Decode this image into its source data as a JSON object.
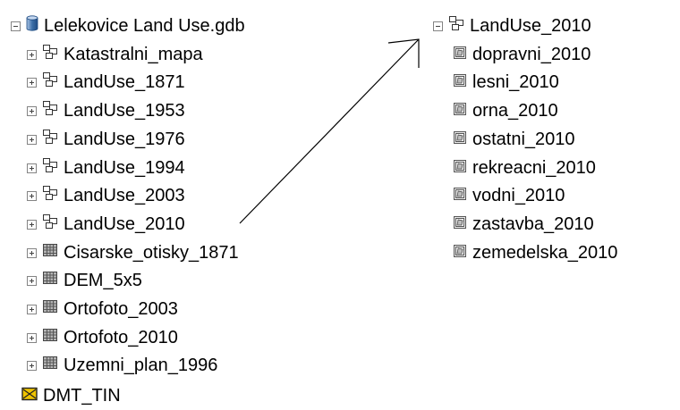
{
  "left_tree": {
    "root": {
      "label": "Lelekovice Land Use.gdb",
      "icon": "database-icon"
    },
    "items": [
      {
        "label": "Katastralni_mapa",
        "icon": "feature-dataset-icon"
      },
      {
        "label": "LandUse_1871",
        "icon": "feature-dataset-icon"
      },
      {
        "label": "LandUse_1953",
        "icon": "feature-dataset-icon"
      },
      {
        "label": "LandUse_1976",
        "icon": "feature-dataset-icon"
      },
      {
        "label": "LandUse_1994",
        "icon": "feature-dataset-icon"
      },
      {
        "label": "LandUse_2003",
        "icon": "feature-dataset-icon"
      },
      {
        "label": "LandUse_2010",
        "icon": "feature-dataset-icon"
      },
      {
        "label": "Cisarske_otisky_1871",
        "icon": "raster-dataset-icon"
      },
      {
        "label": "DEM_5x5",
        "icon": "raster-dataset-icon"
      },
      {
        "label": "Ortofoto_2003",
        "icon": "raster-dataset-icon"
      },
      {
        "label": "Ortofoto_2010",
        "icon": "raster-dataset-icon"
      },
      {
        "label": "Uzemni_plan_1996",
        "icon": "raster-dataset-icon"
      }
    ],
    "tin": {
      "label": "DMT_TIN",
      "icon": "tin-icon"
    }
  },
  "right_tree": {
    "root": {
      "label": "LandUse_2010",
      "icon": "feature-dataset-icon"
    },
    "items": [
      {
        "label": "dopravni_2010",
        "icon": "polygon-feature-class-icon"
      },
      {
        "label": "lesni_2010",
        "icon": "polygon-feature-class-icon"
      },
      {
        "label": "orna_2010",
        "icon": "polygon-feature-class-icon"
      },
      {
        "label": "ostatni_2010",
        "icon": "polygon-feature-class-icon"
      },
      {
        "label": "rekreacni_2010",
        "icon": "polygon-feature-class-icon"
      },
      {
        "label": "vodni_2010",
        "icon": "polygon-feature-class-icon"
      },
      {
        "label": "zastavba_2010",
        "icon": "polygon-feature-class-icon"
      },
      {
        "label": "zemedelska_2010",
        "icon": "polygon-feature-class-icon"
      }
    ]
  },
  "colors": {
    "text": "#000000",
    "expander": "#848484",
    "database": "#3c6fa8",
    "raster": "#6b6b6b",
    "tin": "#e8c000"
  }
}
